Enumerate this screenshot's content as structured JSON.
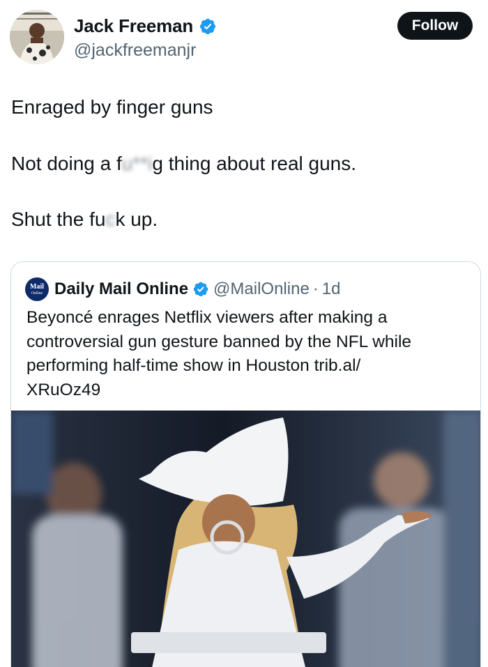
{
  "author": {
    "name": "Jack Freeman",
    "handle": "@jackfreemanjr",
    "verified": true
  },
  "follow_label": "Follow",
  "tweet_lines": {
    "line1": "Enraged by finger guns",
    "line2_pre": "Not doing a f",
    "line2_blur": "u**i",
    "line2_post": "g thing about real guns.",
    "line3_pre": "Shut the fu",
    "line3_blur": "c",
    "line3_post": "k up."
  },
  "quote": {
    "logo_top": "Mail",
    "logo_bottom": "Online",
    "name": "Daily Mail Online",
    "handle": "@MailOnline",
    "separator": "·",
    "time": "1d",
    "text_lines": [
      "Beyoncé enrages Netflix viewers after making a",
      "controversial gun gesture banned by the NFL while",
      "performing half-time show in Houston trib.al/",
      "XRuOz49"
    ]
  },
  "colors": {
    "text": "#0f1419",
    "secondary": "#536471",
    "verified": "#1d9bf0",
    "follow_bg": "#0f1419",
    "mail_logo": "#0e2a6b"
  },
  "icons": {
    "verified": "verified-badge-icon",
    "avatar": "profile-photo"
  }
}
